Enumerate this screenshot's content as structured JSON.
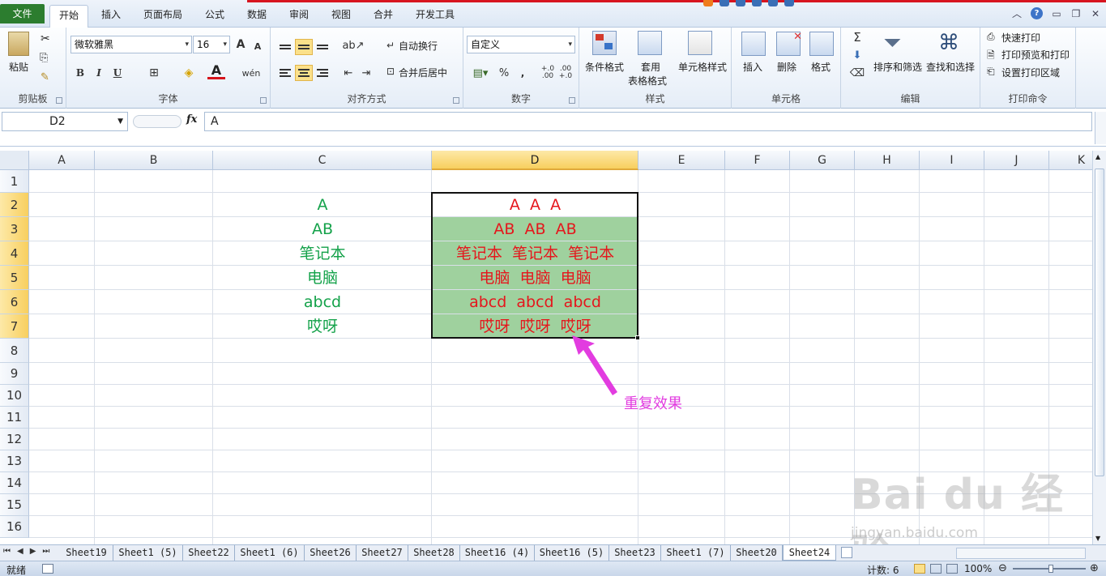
{
  "ribbon_tabs": [
    "文件",
    "开始",
    "插入",
    "页面布局",
    "公式",
    "数据",
    "审阅",
    "视图",
    "合并",
    "开发工具"
  ],
  "clipboard": {
    "paste": "粘贴",
    "label": "剪贴板"
  },
  "font": {
    "name": "微软雅黑",
    "size": "16",
    "label": "字体",
    "bold": "B",
    "italic": "I",
    "underline": "U",
    "grow": "A",
    "shrink": "A",
    "color_glyph": "A",
    "wen": "wén"
  },
  "alignment": {
    "wrap": "自动换行",
    "merge": "合并后居中",
    "label": "对齐方式"
  },
  "number": {
    "format": "自定义",
    "percent": "%",
    "comma": ",",
    "inc": "+.0 .00",
    "dec": ".00 +.0",
    "label": "数字"
  },
  "styles": {
    "cond": "条件格式",
    "table1": "套用",
    "table2": "表格格式",
    "cell": "单元格样式",
    "label": "样式"
  },
  "cells": {
    "insert": "插入",
    "delete": "删除",
    "format": "格式",
    "label": "单元格"
  },
  "editing": {
    "sigma": "Σ",
    "sort": "排序和筛选",
    "find": "查找和选择",
    "label": "编辑"
  },
  "print": {
    "quick": "快速打印",
    "preview": "打印预览和打印",
    "area": "设置打印区域",
    "label": "打印命令"
  },
  "formula_bar": {
    "cell_ref": "D2",
    "fx": "fx",
    "value": "A"
  },
  "columns": [
    "A",
    "B",
    "C",
    "D",
    "E",
    "F",
    "G",
    "H",
    "I",
    "J",
    "K"
  ],
  "rows": [
    "1",
    "2",
    "3",
    "4",
    "5",
    "6",
    "7",
    "8",
    "9",
    "10",
    "11",
    "12",
    "13",
    "14",
    "15",
    "16"
  ],
  "column_c": [
    "A",
    "AB",
    "笔记本",
    "电脑",
    "abcd",
    "哎呀"
  ],
  "column_d": [
    "A  A  A",
    "AB  AB  AB",
    "笔记本  笔记本  笔记本",
    "电脑  电脑  电脑",
    "abcd  abcd  abcd",
    "哎呀  哎呀  哎呀"
  ],
  "annotation": "重复效果",
  "sheet_tabs": [
    "Sheet19",
    "Sheet1 (5)",
    "Sheet22",
    "Sheet1 (6)",
    "Sheet26",
    "Sheet27",
    "Sheet28",
    "Sheet16 (4)",
    "Sheet16 (5)",
    "Sheet23",
    "Sheet1 (7)",
    "Sheet20",
    "Sheet24"
  ],
  "active_sheet": "Sheet24",
  "status": {
    "ready": "就绪",
    "count": "计数: 6",
    "zoom": "100%"
  },
  "watermark": {
    "main": "Bai du 经验",
    "sub": "jingyan.baidu.com"
  },
  "colors": {
    "green_text": "#14a24a",
    "red_text": "#e5161c",
    "fill": "#9fd19e",
    "annotation": "#e23ce0",
    "file_tab": "#2c7d2f"
  }
}
